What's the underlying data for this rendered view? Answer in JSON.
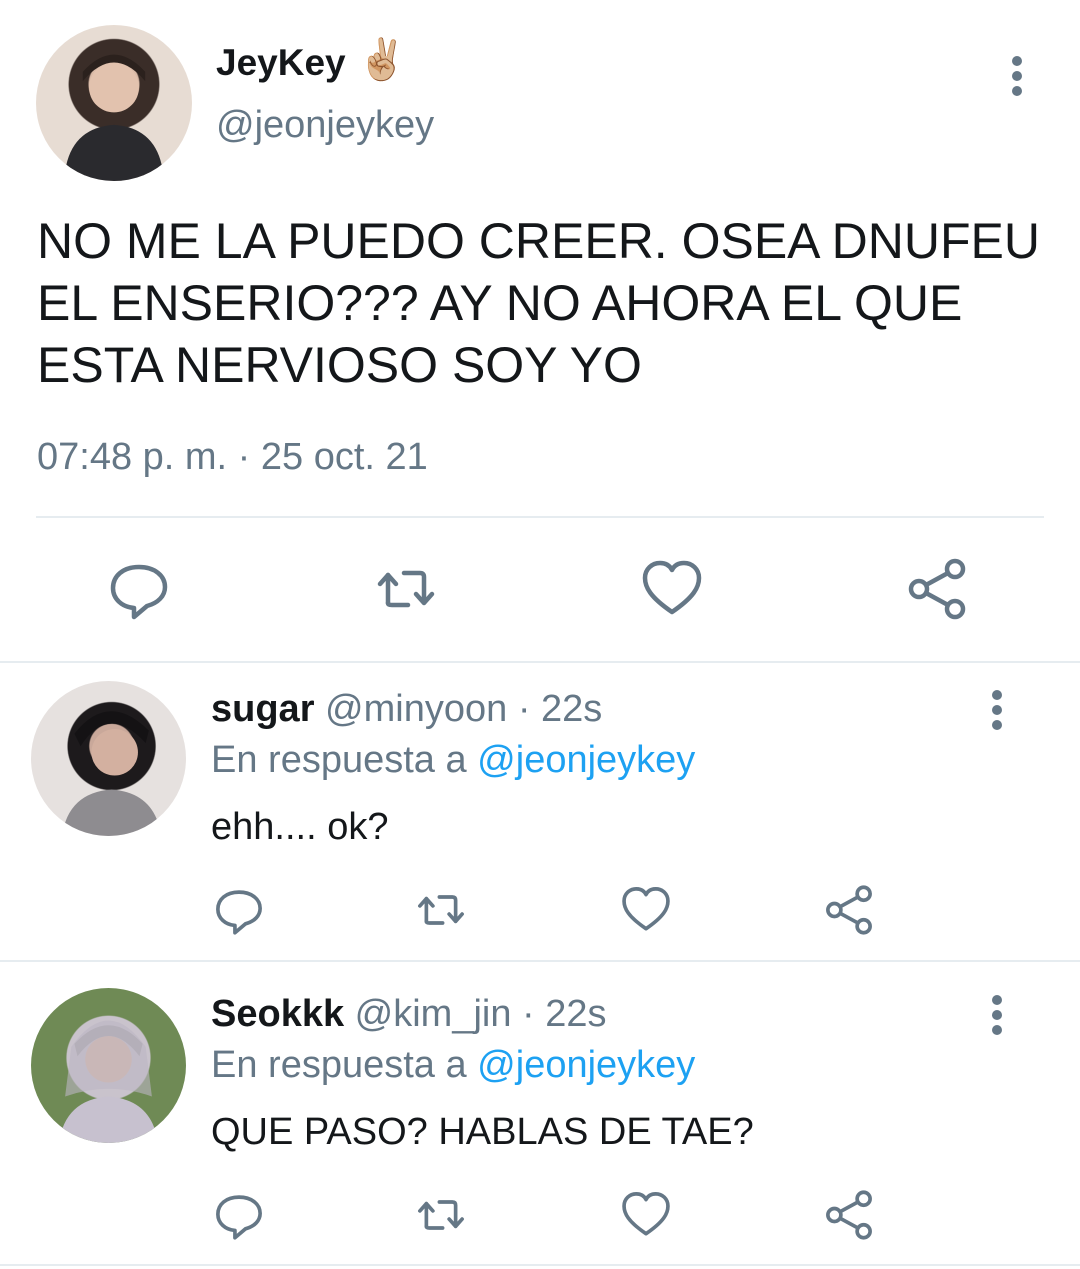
{
  "tweet": {
    "display_name": "JeyKey",
    "emoji": "✌🏼",
    "handle": "@jeonjeykey",
    "text": "NO ME LA PUEDO CREER. OSEA DNUFEU EL ENSERIO??? AY NO AHORA EL QUE ESTA NERVIOSO SOY YO",
    "timestamp": "07:48 p. m. · 25 oct. 21",
    "actions": [
      "reply-icon",
      "retweet-icon",
      "like-icon",
      "share-icon"
    ]
  },
  "replies": [
    {
      "display_name": "sugar",
      "handle": "@minyoon",
      "age": "· 22s",
      "reply_prefix": "En respuesta a",
      "reply_to": "@jeonjeykey",
      "text": "ehh.... ok?"
    },
    {
      "display_name": "Seokkk",
      "handle": "@kim_jin",
      "age": "· 22s",
      "reply_prefix": "En respuesta a",
      "reply_to": "@jeonjeykey",
      "text": "QUE PASO? HABLAS DE TAE?"
    }
  ],
  "colors": {
    "text": "#14171a",
    "secondary": "#657786",
    "mention": "#1da1f2",
    "divider": "#e6ecf0"
  }
}
